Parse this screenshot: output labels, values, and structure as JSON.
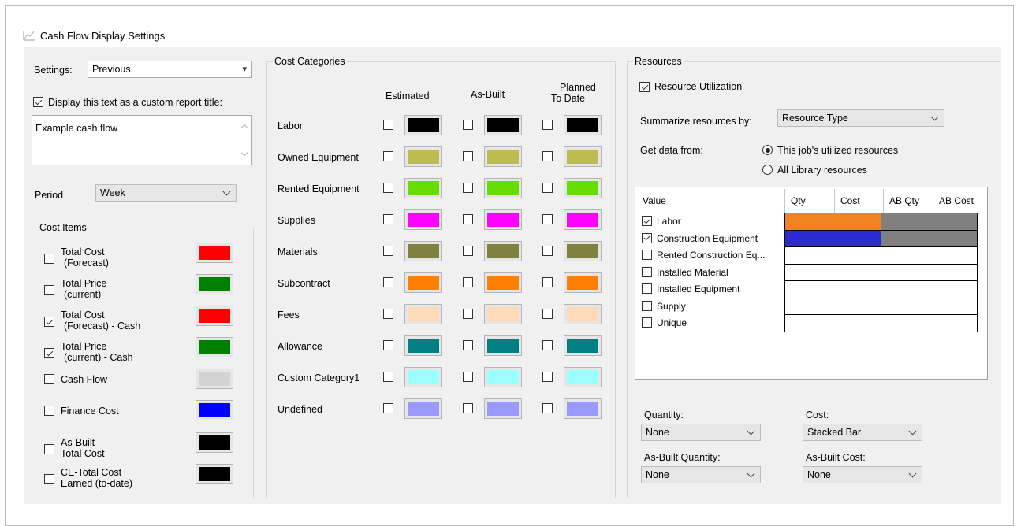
{
  "title": "Cash Flow Display Settings",
  "settings": {
    "label": "Settings:",
    "value": "Previous",
    "custom_title_label": "Display this text as a custom report title:",
    "custom_title_checked": true,
    "custom_title_text": "Example cash flow",
    "period_label": "Period",
    "period_value": "Week"
  },
  "cost_items": {
    "group_label": "Cost Items",
    "items": [
      {
        "label1": "Total Cost",
        "label2": "(Forecast)",
        "checked": false,
        "color": "#ff0000"
      },
      {
        "label1": "Total Price",
        "label2": "(current)",
        "checked": false,
        "color": "#008000"
      },
      {
        "label1": "Total Cost",
        "label2": "(Forecast) - Cash",
        "checked": true,
        "color": "#ff0000"
      },
      {
        "label1": "Total Price",
        "label2": "(current) - Cash",
        "checked": true,
        "color": "#008000"
      },
      {
        "label1": "Cash Flow",
        "label2": "",
        "checked": false,
        "color": "#d3d3d3"
      },
      {
        "label1": "Finance Cost",
        "label2": "",
        "checked": false,
        "color": "#0000ff"
      },
      {
        "label1": "As-Built",
        "label2": "Total Cost",
        "checked": false,
        "color": "#000000"
      },
      {
        "label1": "CE-Total Cost",
        "label2": "Earned (to-date)",
        "checked": false,
        "color": "#000000"
      }
    ]
  },
  "cost_categories": {
    "group_label": "Cost Categories",
    "col_estimated": "Estimated",
    "col_asbuilt": "As-Built",
    "col_planned1": "Planned",
    "col_planned2": "To Date",
    "rows": [
      {
        "label": "Labor",
        "color": "#000000"
      },
      {
        "label": "Owned Equipment",
        "color": "#bdbd4f"
      },
      {
        "label": "Rented Equipment",
        "color": "#66dd00"
      },
      {
        "label": "Supplies",
        "color": "#ff00ff"
      },
      {
        "label": "Materials",
        "color": "#808040"
      },
      {
        "label": "Subcontract",
        "color": "#ff8000"
      },
      {
        "label": "Fees",
        "color": "#ffdab9"
      },
      {
        "label": "Allowance",
        "color": "#008080"
      },
      {
        "label": "Custom Category1",
        "color": "#99ffff"
      },
      {
        "label": "Undefined",
        "color": "#9999ff"
      }
    ]
  },
  "resources": {
    "group_label": "Resources",
    "utilization_label": "Resource Utilization",
    "utilization_checked": true,
    "summarize_label": "Summarize resources by:",
    "summarize_value": "Resource Type",
    "get_data_label": "Get data from:",
    "radio_job": "This job's utilized resources",
    "radio_library": "All Library resources",
    "radio_selected": "job",
    "table": {
      "headers": [
        "Value",
        "Qty",
        "Cost",
        "AB Qty",
        "AB Cost"
      ],
      "rows": [
        {
          "label": "Labor",
          "checked": true,
          "colors": [
            "#ef8520",
            "#ef8520",
            "#808080",
            "#808080"
          ]
        },
        {
          "label": "Construction Equipment",
          "checked": true,
          "colors": [
            "#2b2bd1",
            "#2b2bd1",
            "#808080",
            "#808080"
          ]
        },
        {
          "label": "Rented Construction Eq...",
          "checked": false,
          "colors": [
            "#ffffff",
            "#ffffff",
            "#ffffff",
            "#ffffff"
          ]
        },
        {
          "label": "Installed Material",
          "checked": false,
          "colors": [
            "#ffffff",
            "#ffffff",
            "#ffffff",
            "#ffffff"
          ]
        },
        {
          "label": "Installed Equipment",
          "checked": false,
          "colors": [
            "#ffffff",
            "#ffffff",
            "#ffffff",
            "#ffffff"
          ]
        },
        {
          "label": "Supply",
          "checked": false,
          "colors": [
            "#ffffff",
            "#ffffff",
            "#ffffff",
            "#ffffff"
          ]
        },
        {
          "label": "Unique",
          "checked": false,
          "colors": [
            "#ffffff",
            "#ffffff",
            "#ffffff",
            "#ffffff"
          ]
        }
      ]
    },
    "quantity_label": "Quantity:",
    "quantity_value": "None",
    "cost_label": "Cost:",
    "cost_value": "Stacked Bar",
    "ab_quantity_label": "As-Built Quantity:",
    "ab_quantity_value": "None",
    "ab_cost_label": "As-Built Cost:",
    "ab_cost_value": "None"
  }
}
